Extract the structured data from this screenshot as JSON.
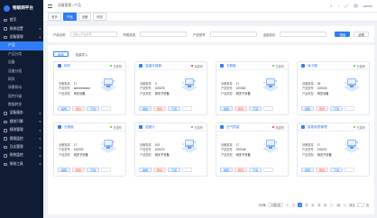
{
  "app": {
    "name": "物联网平台"
  },
  "sidebar": {
    "items": [
      {
        "label": "首页",
        "type": "group"
      },
      {
        "label": "系统设置",
        "type": "group",
        "arrow": "▾"
      },
      {
        "label": "设备管理",
        "type": "group",
        "arrow": "▴"
      },
      {
        "label": "产品",
        "type": "active"
      },
      {
        "label": "产品分类",
        "type": "sub"
      },
      {
        "label": "设备",
        "type": "sub"
      },
      {
        "label": "设备分组",
        "type": "sub"
      },
      {
        "label": "网关",
        "type": "sub"
      },
      {
        "label": "场景联动",
        "type": "sub"
      },
      {
        "label": "固件升级",
        "type": "sub"
      },
      {
        "label": "数据转发",
        "type": "sub"
      },
      {
        "label": "设备服务",
        "type": "group",
        "arrow": "▾"
      },
      {
        "label": "规则引擎",
        "type": "group",
        "arrow": "▾"
      },
      {
        "label": "规则管理",
        "type": "group",
        "arrow": "▾"
      },
      {
        "label": "视频监控",
        "type": "group",
        "arrow": "▾"
      },
      {
        "label": "日志管理",
        "type": "group",
        "arrow": "▾"
      },
      {
        "label": "系统监控",
        "type": "group",
        "arrow": "▾"
      },
      {
        "label": "系统工具",
        "type": "group",
        "arrow": "▾"
      }
    ]
  },
  "topbar": {
    "breadcrumb": "设备管理 / 产品",
    "username": "admin"
  },
  "tabs": [
    {
      "label": "首页",
      "active": false
    },
    {
      "label": "产品",
      "active": true
    },
    {
      "label": "设备",
      "active": false
    },
    {
      "label": "网关",
      "active": false
    }
  ],
  "filter": {
    "fields": [
      {
        "label": "产品名称",
        "placeholder": "请输入产品名称"
      },
      {
        "label": "所属品类",
        "placeholder": ""
      },
      {
        "label": "产品型号",
        "placeholder": ""
      },
      {
        "label": "连接协议",
        "placeholder": ""
      }
    ],
    "search_label": "搜索",
    "reset_label": "重置"
  },
  "actions": {
    "add_label": "新增",
    "import_label": "批量导入"
  },
  "card_labels": {
    "devices": "设备数量",
    "model": "产品型号",
    "protocol": "产品类型",
    "edit": "编辑",
    "delete": "删除",
    "download": "下载",
    "more": "···"
  },
  "cards": [
    {
      "name": "网关",
      "status": "已发布",
      "status_color": "#52c41a",
      "devices": "17",
      "model": "administrator",
      "protocol": "网关设备"
    },
    {
      "name": "温度传感器",
      "status": "未发布",
      "status_color": "#f5222d",
      "devices": "3",
      "model": "100678",
      "protocol": "网关子设备"
    },
    {
      "name": "光照度",
      "status": "已发布",
      "status_color": "#52c41a",
      "devices": "17",
      "model": "100082",
      "protocol": "网关子设备"
    },
    {
      "name": "读卡器",
      "status": "已发布",
      "status_color": "#52c41a",
      "devices": "26",
      "model": "100043",
      "protocol": "网关设备"
    },
    {
      "name": "光照度",
      "status": "已发布",
      "status_color": "#52c41a",
      "devices": "17",
      "model": "100003",
      "protocol": "网关子设备"
    },
    {
      "name": "湿度计",
      "status": "已发布",
      "status_color": "#52c41a",
      "devices": "100",
      "model": "100076",
      "protocol": "网关子设备"
    },
    {
      "name": "空气质量",
      "status": "未发布",
      "status_color": "#f5222d",
      "devices": "17",
      "model": "220048",
      "protocol": "网关子设备"
    },
    {
      "name": "智能电表管理",
      "status": "已发布",
      "status_color": "#52c41a",
      "devices": "17",
      "model": "100021",
      "protocol": "网关子设备"
    }
  ],
  "pagination": {
    "total_label": "共8条",
    "page_size": "10条/页",
    "prev": "‹",
    "pages": [
      "1",
      "2",
      "3",
      "4",
      "5",
      "6",
      "···",
      "10"
    ],
    "current": "2",
    "next": "›",
    "goto_label": "前往",
    "page_unit": "页"
  },
  "colors": {
    "primary": "#2f7df6",
    "sidebar_bg": "#101c33"
  }
}
